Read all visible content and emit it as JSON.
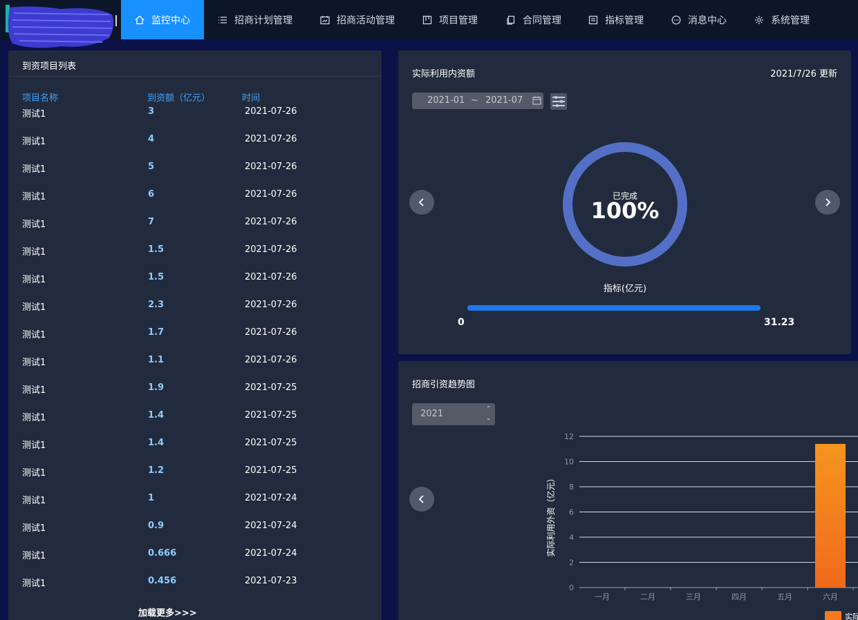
{
  "nav": {
    "items": [
      {
        "label": "监控中心",
        "icon": "home-icon",
        "active": true
      },
      {
        "label": "招商计划管理",
        "icon": "list-icon"
      },
      {
        "label": "招商活动管理",
        "icon": "calendar-chart-icon"
      },
      {
        "label": "项目管理",
        "icon": "board-icon"
      },
      {
        "label": "合同管理",
        "icon": "document-icon"
      },
      {
        "label": "指标管理",
        "icon": "form-icon"
      },
      {
        "label": "消息中心",
        "icon": "message-icon"
      },
      {
        "label": "系统管理",
        "icon": "gear-icon"
      }
    ],
    "active_color": "#1890ff"
  },
  "left": {
    "title": "到资项目列表",
    "columns": [
      "项目名称",
      "到资额（亿元）",
      "时间"
    ],
    "rows": [
      {
        "name": "测试1",
        "amount": "3",
        "time": "2021-07-26"
      },
      {
        "name": "测试1",
        "amount": "4",
        "time": "2021-07-26"
      },
      {
        "name": "测试1",
        "amount": "5",
        "time": "2021-07-26"
      },
      {
        "name": "测试1",
        "amount": "6",
        "time": "2021-07-26"
      },
      {
        "name": "测试1",
        "amount": "7",
        "time": "2021-07-26"
      },
      {
        "name": "测试1",
        "amount": "1.5",
        "time": "2021-07-26"
      },
      {
        "name": "测试1",
        "amount": "1.5",
        "time": "2021-07-26"
      },
      {
        "name": "测试1",
        "amount": "2.3",
        "time": "2021-07-26"
      },
      {
        "name": "测试1",
        "amount": "1.7",
        "time": "2021-07-26"
      },
      {
        "name": "测试1",
        "amount": "1.1",
        "time": "2021-07-26"
      },
      {
        "name": "测试1",
        "amount": "1.9",
        "time": "2021-07-25"
      },
      {
        "name": "测试1",
        "amount": "1.4",
        "time": "2021-07-25"
      },
      {
        "name": "测试1",
        "amount": "1.4",
        "time": "2021-07-25"
      },
      {
        "name": "测试1",
        "amount": "1.2",
        "time": "2021-07-25"
      },
      {
        "name": "测试1",
        "amount": "1",
        "time": "2021-07-24"
      },
      {
        "name": "测试1",
        "amount": "0.9",
        "time": "2021-07-24"
      },
      {
        "name": "测试1",
        "amount": "0.666",
        "time": "2021-07-24"
      },
      {
        "name": "测试1",
        "amount": "0.456",
        "time": "2021-07-23"
      }
    ],
    "load_more": "加载更多>>>"
  },
  "usage": {
    "title": "实际利用内资额",
    "updated": "2021/7/26 更新",
    "date_start": "2021-01",
    "date_sep": "~",
    "date_end": "2021-07",
    "ring_label": "已完成",
    "ring_value": "100%",
    "ring_fraction": 1.0,
    "ring_color": "#5470c6",
    "metric_label": "指标(亿元)",
    "progress_min": "0",
    "progress_max": "31.23",
    "progress_fraction": 1.0
  },
  "trend": {
    "title": "招商引资趋势图",
    "year": "2021"
  },
  "chart_data": {
    "type": "bar",
    "title": "",
    "ylabel": "实际利用外资（亿元）",
    "ylim": [
      0,
      12
    ],
    "yticks": [
      "0",
      "2",
      "4",
      "6",
      "8",
      "10",
      "12"
    ],
    "categories": [
      "一月",
      "二月",
      "三月",
      "四月",
      "五月",
      "六月"
    ],
    "series": [
      {
        "name": "实际",
        "values": [
          0,
          0,
          0,
          0,
          0,
          11.4
        ],
        "color": "#f4791e"
      }
    ],
    "grid": true
  }
}
